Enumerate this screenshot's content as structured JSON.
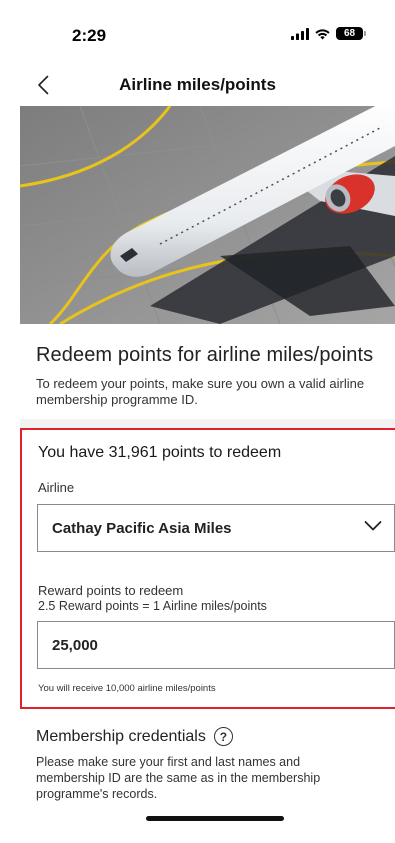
{
  "status_bar": {
    "time": "2:29",
    "battery": "68"
  },
  "nav": {
    "title": "Airline miles/points"
  },
  "intro": {
    "title": "Redeem points for airline miles/points",
    "description": "To redeem your points, make sure you own a valid airline membership programme ID."
  },
  "redeem": {
    "points_heading": "You have 31,961 points to redeem",
    "airline_label": "Airline",
    "airline_value": "Cathay Pacific Asia Miles",
    "reward_label": "Reward points to redeem",
    "rate_text": "2.5 Reward points = 1 Airline miles/points",
    "reward_value": "25,000",
    "receive_note": "You will receive 10,000 airline miles/points"
  },
  "membership": {
    "title": "Membership credentials",
    "description": "Please make sure your first and last names and membership ID are the same as in the membership programme's records."
  },
  "colors": {
    "highlight_border": "#e0202a",
    "engine_red": "#d8322a"
  }
}
